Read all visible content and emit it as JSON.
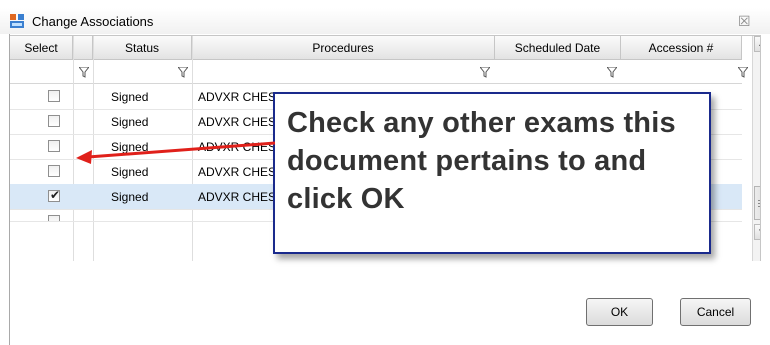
{
  "window": {
    "title": "Change Associations"
  },
  "grid": {
    "columns": [
      "Select",
      "Status",
      "Procedures",
      "Scheduled Date",
      "Accession #"
    ],
    "rows": [
      {
        "checked": false,
        "status": "Signed",
        "procedure": "ADVXR CHES"
      },
      {
        "checked": false,
        "status": "Signed",
        "procedure": "ADVXR CHES"
      },
      {
        "checked": false,
        "status": "Signed",
        "procedure": "ADVXR CHES"
      },
      {
        "checked": false,
        "status": "Signed",
        "procedure": "ADVXR CHES"
      },
      {
        "checked": true,
        "status": "Signed",
        "procedure": "ADVXR CHES"
      }
    ]
  },
  "buttons": {
    "ok": "OK",
    "cancel": "Cancel"
  },
  "callout": {
    "text": "Check any other exams this document pertains to and click OK"
  },
  "colors": {
    "callout_border": "#1a2a8c",
    "arrow": "#e0201a",
    "selected_row": "#d9e8f7"
  },
  "icons": [
    "app-icon",
    "close-icon",
    "filter-icon",
    "checkbox-checked-icon",
    "scroll-up-icon",
    "scroll-down-icon"
  ]
}
